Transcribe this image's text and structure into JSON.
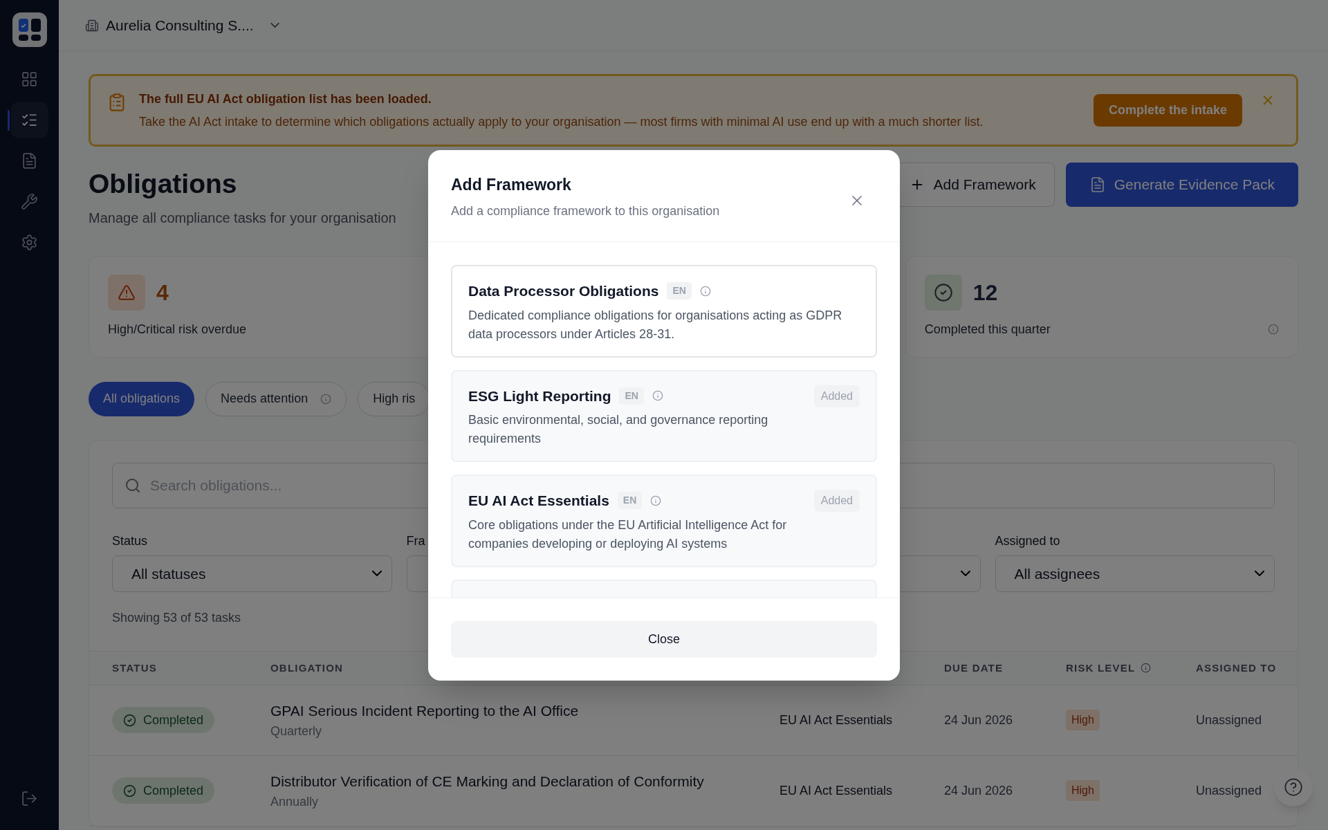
{
  "sidebar": {
    "items": [
      {
        "kind": "dashboard",
        "selected": false
      },
      {
        "kind": "obligations",
        "selected": true
      },
      {
        "kind": "documents",
        "selected": false
      },
      {
        "kind": "tools",
        "selected": false
      },
      {
        "kind": "settings",
        "selected": false
      }
    ]
  },
  "org_switcher": {
    "name": "Aurelia Consulting S...."
  },
  "banner": {
    "title": "The full EU AI Act obligation list has been loaded.",
    "message": "Take the AI Act intake to determine which obligations actually apply to your organisation — most firms with minimal AI use end up with a much shorter list.",
    "action": "Complete the intake"
  },
  "page": {
    "title": "Obligations",
    "subtitle": "Manage all compliance tasks for your organisation",
    "actions": [
      {
        "label": "Add Framework",
        "kind": "secondary"
      },
      {
        "label": "Generate Evidence Pack",
        "kind": "primary"
      }
    ]
  },
  "stats": [
    {
      "value": "4",
      "label": "High/Critical risk overdue",
      "kind": "warning",
      "info": false
    },
    {
      "value": "12",
      "label": "Completed this quarter",
      "kind": "success",
      "info": true
    }
  ],
  "filter_tabs": [
    {
      "label": "All obligations",
      "selected": true,
      "info": false
    },
    {
      "label": "Needs attention",
      "selected": false,
      "info": true
    },
    {
      "label": "High ris",
      "selected": false,
      "info": false
    }
  ],
  "search": {
    "placeholder": "Search obligations..."
  },
  "filters": [
    {
      "label": "Status",
      "value": "All statuses"
    },
    {
      "label": "Fra"
    },
    {
      "label": "Assigned to",
      "value": "All assignees"
    }
  ],
  "result_count": "Showing 53 of 53 tasks",
  "table": {
    "columns": [
      {
        "label": "STATUS",
        "info": false
      },
      {
        "label": "OBLIGATION",
        "info": false
      },
      {
        "label": "DUE DATE",
        "info": false
      },
      {
        "label": "RISK LEVEL",
        "info": true
      },
      {
        "label": "ASSIGNED TO",
        "info": false
      }
    ],
    "rows": [
      {
        "status": "Completed",
        "title": "GPAI Serious Incident Reporting to the AI Office",
        "frequency": "Quarterly",
        "framework": "EU AI Act Essentials",
        "due_date": "24 Jun 2026",
        "risk": "High",
        "assignee": "Unassigned"
      },
      {
        "status": "Completed",
        "title": "Distributor Verification of CE Marking and Declaration of Conformity",
        "frequency": "Annually",
        "framework": "EU AI Act Essentials",
        "due_date": "24 Jun 2026",
        "risk": "High",
        "assignee": "Unassigned"
      }
    ]
  },
  "dialog": {
    "title": "Add Framework",
    "subtitle": "Add a compliance framework to this organisation",
    "frameworks": [
      {
        "name": "Data Processor Obligations",
        "language": "EN",
        "description": "Dedicated compliance obligations for organisations acting as GDPR data processors under Articles 28-31.",
        "added": false
      },
      {
        "name": "ESG Light Reporting",
        "language": "EN",
        "description": "Basic environmental, social, and governance reporting requirements",
        "added": true,
        "status_label": "Added"
      },
      {
        "name": "EU AI Act Essentials",
        "language": "EN",
        "description": "Core obligations under the EU Artificial Intelligence Act for companies developing or deploying AI systems",
        "added": true,
        "status_label": "Added"
      }
    ],
    "close_label": "Close"
  }
}
